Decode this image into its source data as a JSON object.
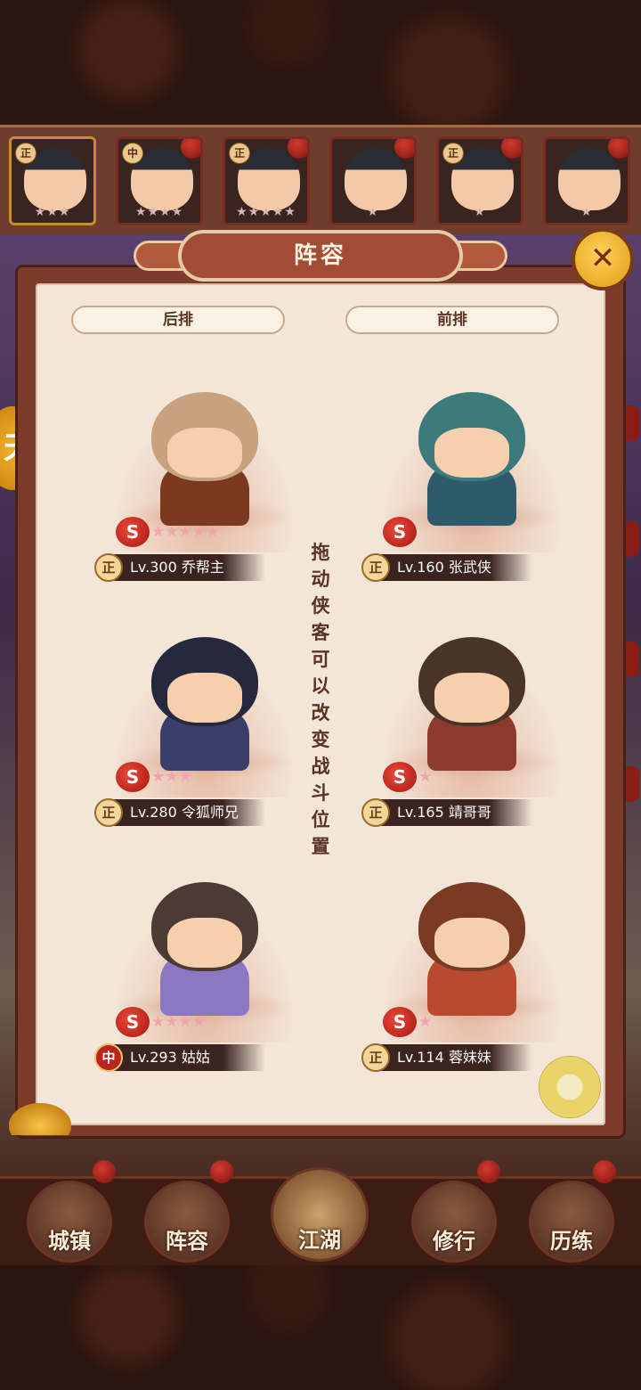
{
  "hero_strip": [
    {
      "tag": "正",
      "stars": "★★★"
    },
    {
      "tag": "中",
      "stars": "★★★★"
    },
    {
      "tag": "正",
      "stars": "★★★★★"
    },
    {
      "tag": "",
      "stars": "★"
    },
    {
      "tag": "正",
      "stars": "★"
    },
    {
      "tag": "",
      "stars": "★"
    }
  ],
  "panel": {
    "title": "阵容",
    "close_icon": "✕",
    "back_row_label": "后排",
    "front_row_label": "前排",
    "hint": "拖动侠客可以改变战斗位置"
  },
  "slots": [
    {
      "camp": "正",
      "level": "Lv.300",
      "name": "乔帮主",
      "rank": "S",
      "stars": "★★★★★"
    },
    {
      "camp": "正",
      "level": "Lv.160",
      "name": "张武侠",
      "rank": "S",
      "stars": ""
    },
    {
      "camp": "正",
      "level": "Lv.280",
      "name": "令狐师兄",
      "rank": "S",
      "stars": "★★★"
    },
    {
      "camp": "正",
      "level": "Lv.165",
      "name": "靖哥哥",
      "rank": "S",
      "stars": "★"
    },
    {
      "camp": "中",
      "level": "Lv.293",
      "name": "姑姑",
      "rank": "S",
      "stars": "★★★★"
    },
    {
      "camp": "正",
      "level": "Lv.114",
      "name": "蓉妹妹",
      "rank": "S",
      "stars": "★"
    }
  ],
  "side_button_label": "天",
  "bottom_nav": [
    "城镇",
    "阵容",
    "江湖",
    "修行",
    "历练"
  ]
}
